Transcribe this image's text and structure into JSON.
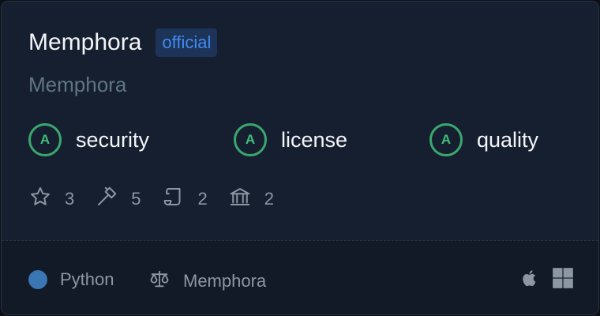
{
  "header": {
    "title": "Memphora",
    "badge": "official"
  },
  "subtitle": "Memphora",
  "grades": [
    {
      "grade": "A",
      "label": "security"
    },
    {
      "grade": "A",
      "label": "license"
    },
    {
      "grade": "A",
      "label": "quality"
    }
  ],
  "stats": [
    {
      "icon": "star-icon",
      "value": "3"
    },
    {
      "icon": "hammer-icon",
      "value": "5"
    },
    {
      "icon": "scroll-icon",
      "value": "2"
    },
    {
      "icon": "bank-icon",
      "value": "2"
    }
  ],
  "footer": {
    "language": "Python",
    "language_color": "#3a76b3",
    "license": "Memphora",
    "platforms": [
      "apple-icon",
      "windows-icon"
    ]
  },
  "colors": {
    "card_bg": "#161f30",
    "footer_bg": "#121a28",
    "grade_green": "#3aa76d",
    "badge_blue": "#3f8cf0"
  }
}
